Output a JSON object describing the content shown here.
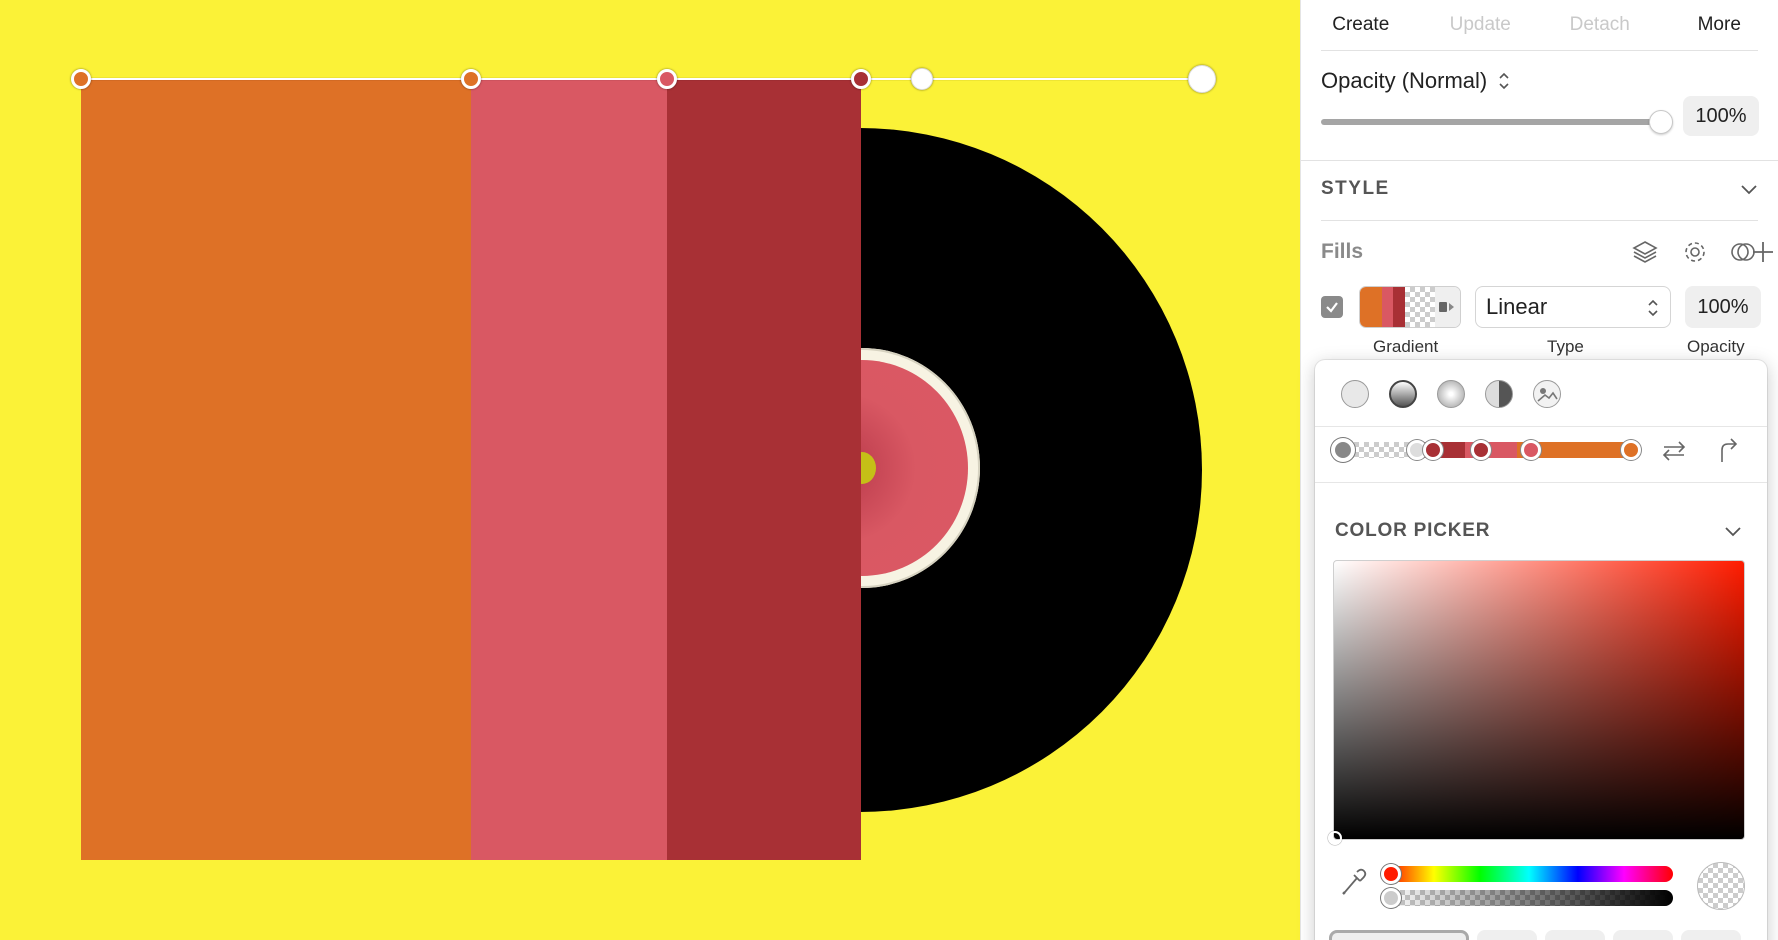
{
  "toolbar": {
    "tabs": [
      {
        "label": "Create",
        "enabled": true
      },
      {
        "label": "Update",
        "enabled": false
      },
      {
        "label": "Detach",
        "enabled": false
      },
      {
        "label": "More",
        "enabled": true
      }
    ]
  },
  "layer_opacity": {
    "label": "Opacity (Normal)",
    "value": "100%"
  },
  "style": {
    "header": "STYLE",
    "fills_label": "Fills",
    "fills_icons": [
      "layers-icon",
      "gear-icon",
      "overlap-circles-icon",
      "plus-icon"
    ],
    "fill": {
      "enabled": true,
      "type": "Linear",
      "opacity": "100%",
      "labels": {
        "gradient": "Gradient",
        "type": "Type",
        "opacity": "Opacity"
      }
    }
  },
  "popover": {
    "fill_types": [
      "solid-fill-icon",
      "linear-gradient-icon",
      "radial-gradient-icon",
      "angular-gradient-icon",
      "image-fill-icon"
    ],
    "selected_fill_type": "linear-gradient-icon",
    "color_picker_header": "COLOR PICKER",
    "gradient_stops": [
      "transparent",
      "#a83035",
      "#d95863",
      "#d95863",
      "#de7126"
    ],
    "current_color": "#ff1c00"
  },
  "canvas": {
    "background": "#fbf237",
    "bands": [
      "#de7126",
      "#d95863",
      "#a83035"
    ],
    "vinyl": "#000000"
  }
}
